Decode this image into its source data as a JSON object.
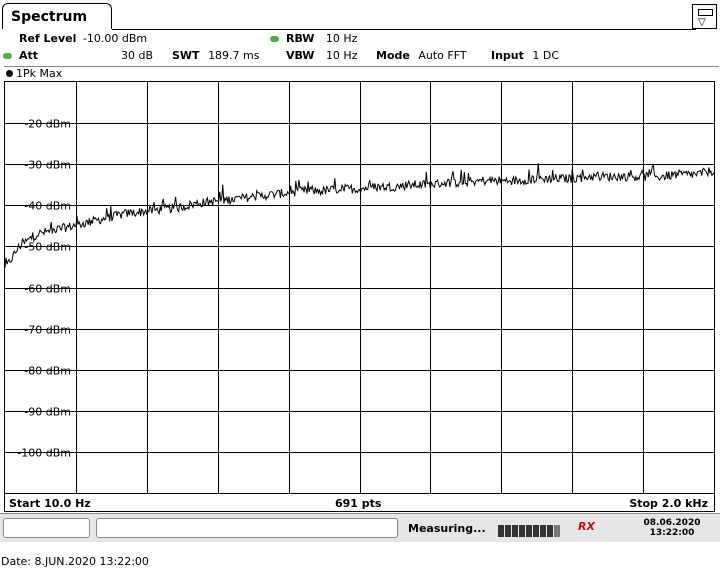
{
  "tab": {
    "title": "Spectrum"
  },
  "settings": {
    "ref_level_label": "Ref Level",
    "ref_level_value": "-10.00 dBm",
    "att_label": "Att",
    "att_value": "30 dB",
    "swt_label": "SWT",
    "swt_value": "189.7 ms",
    "rbw_label": "RBW",
    "rbw_value": "10 Hz",
    "vbw_label": "VBW",
    "vbw_value": "10 Hz",
    "mode_label": "Mode",
    "mode_value": "Auto FFT",
    "input_label": "Input",
    "input_value": "1 DC",
    "indicator_color": "#4fb048"
  },
  "trace": {
    "label": "1Pk Max"
  },
  "footer": {
    "start": "Start 10.0 Hz",
    "points": "691 pts",
    "stop": "Stop 2.0 kHz"
  },
  "status": {
    "measuring": "Measuring...",
    "date": "08.06.2020",
    "time": "13:22:00",
    "rx_logo": "RX"
  },
  "bottom_date": "Date: 8.JUN.2020  13:22:00",
  "chart_data": {
    "type": "line",
    "xlabel": "",
    "ylabel": "",
    "x_start_hz": 10.0,
    "x_stop_hz": 2000.0,
    "points": 691,
    "ylim": [
      -110,
      -10
    ],
    "y_ticks": [
      "-20 dBm",
      "-30 dBm",
      "-40 dBm",
      "-50 dBm",
      "-60 dBm",
      "-70 dBm",
      "-80 dBm",
      "-90 dBm",
      "-100 dBm"
    ],
    "y_tick_values": [
      -20,
      -30,
      -40,
      -50,
      -60,
      -70,
      -80,
      -90,
      -100
    ],
    "grid": true,
    "trace_color": "#000000",
    "series": [
      {
        "x": [
          10,
          50,
          100,
          150,
          200,
          250,
          300,
          350,
          400,
          450,
          500,
          550,
          600,
          650,
          700,
          750,
          800,
          850,
          900,
          950,
          1000,
          1050,
          1100,
          1150,
          1200,
          1250,
          1300,
          1350,
          1400,
          1450,
          1500,
          1550,
          1600,
          1650,
          1700,
          1750,
          1800,
          1850,
          1900,
          1950,
          2000
        ],
        "values": [
          -55.5,
          -50,
          -47,
          -46,
          -45,
          -44,
          -43,
          -42,
          -41.5,
          -41,
          -40.5,
          -39.5,
          -39,
          -38.5,
          -38,
          -37.5,
          -37,
          -36.5,
          -36.5,
          -36,
          -36,
          -35.5,
          -35.5,
          -35,
          -35,
          -34.5,
          -34.5,
          -34,
          -34,
          -34,
          -33.5,
          -33.5,
          -33.5,
          -33,
          -33,
          -33,
          -33,
          -33,
          -32.5,
          -32.5,
          -31.5
        ]
      }
    ]
  }
}
